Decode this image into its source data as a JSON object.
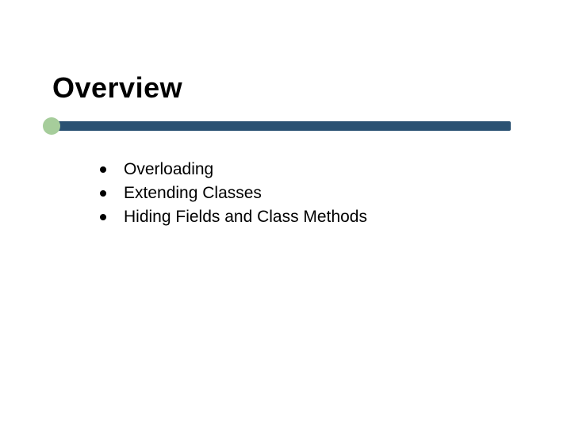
{
  "slide": {
    "title": "Overview",
    "accent_color": "#a6cd9b",
    "bar_color": "#2a5172",
    "bullets": [
      {
        "text": "Overloading"
      },
      {
        "text": "Extending Classes"
      },
      {
        "text": "Hiding Fields and Class Methods"
      }
    ]
  }
}
